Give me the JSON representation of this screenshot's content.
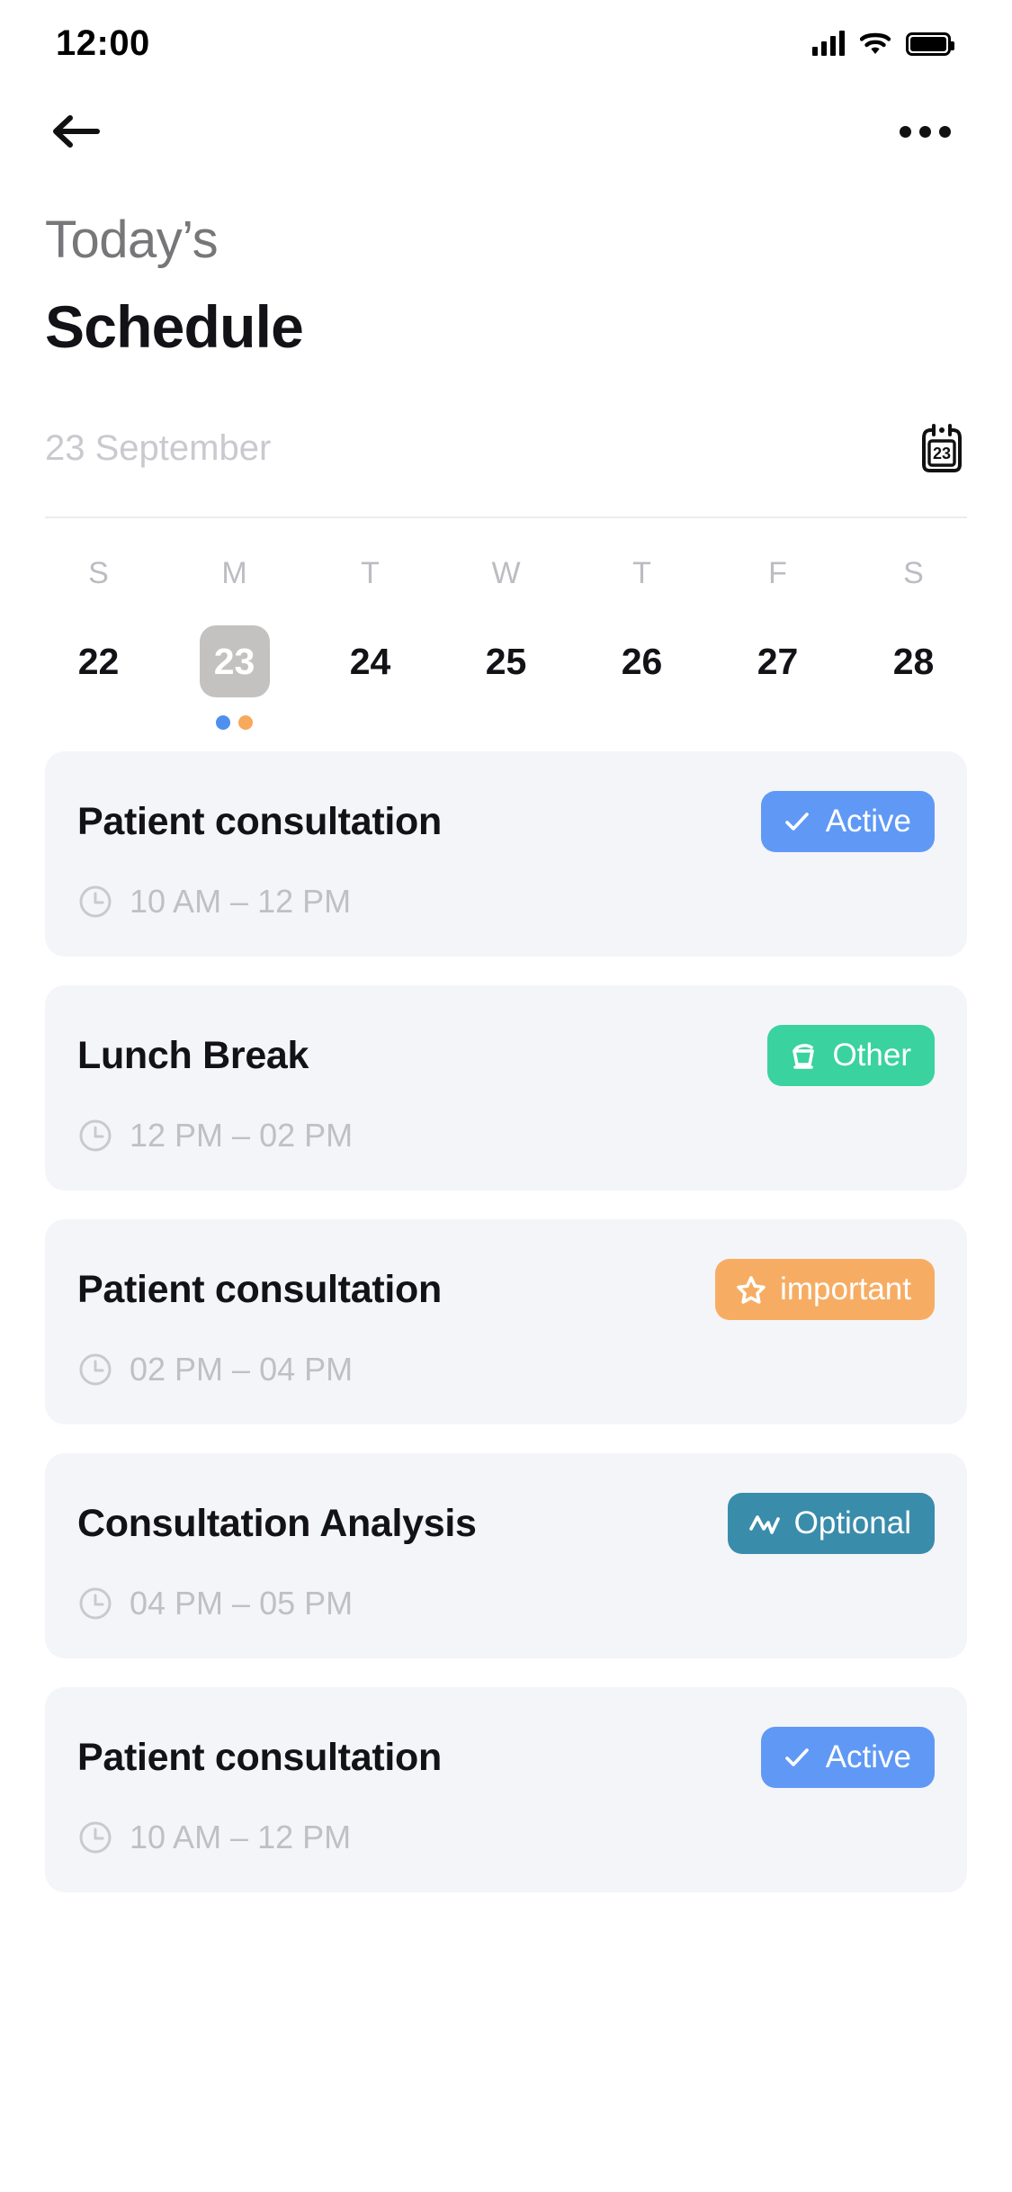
{
  "status_bar": {
    "time": "12:00",
    "signal_icon": "cellular-signal-icon",
    "wifi_icon": "wifi-icon",
    "battery_icon": "battery-full-icon"
  },
  "nav": {
    "back_icon": "arrow-left-icon",
    "more_icon": "more-options-icon"
  },
  "header": {
    "subtitle": "Today’s",
    "title": "Schedule"
  },
  "date_selector": {
    "label": "23 September",
    "calendar_icon": "calendar-icon",
    "calendar_icon_day": "23",
    "weekdays": [
      "S",
      "M",
      "T",
      "W",
      "T",
      "F",
      "S"
    ],
    "days": [
      {
        "num": "22",
        "selected": false,
        "dots": []
      },
      {
        "num": "23",
        "selected": true,
        "dots": [
          "#4f8ff0",
          "#f7a95c"
        ]
      },
      {
        "num": "24",
        "selected": false,
        "dots": []
      },
      {
        "num": "25",
        "selected": false,
        "dots": []
      },
      {
        "num": "26",
        "selected": false,
        "dots": []
      },
      {
        "num": "27",
        "selected": false,
        "dots": []
      },
      {
        "num": "28",
        "selected": false,
        "dots": []
      }
    ],
    "selected_pill_color": "#c4c2c0"
  },
  "events": [
    {
      "title": "Patient consultation",
      "time": "10 AM – 12 PM",
      "time_icon": "clock-icon",
      "badge": {
        "label": "Active",
        "icon": "check-icon",
        "color": "#6099f5"
      }
    },
    {
      "title": "Lunch Break",
      "time": "12 PM – 02 PM",
      "time_icon": "clock-icon",
      "badge": {
        "label": "Other",
        "icon": "coffee-cup-icon",
        "color": "#3ad29f"
      }
    },
    {
      "title": "Patient consultation",
      "time": "02 PM – 04 PM",
      "time_icon": "clock-icon",
      "badge": {
        "label": "important",
        "icon": "star-icon",
        "color": "#f6ad63"
      }
    },
    {
      "title": "Consultation Analysis",
      "time": "04 PM – 05 PM",
      "time_icon": "clock-icon",
      "badge": {
        "label": "Optional",
        "icon": "activity-pulse-icon",
        "color": "#3a8cab"
      }
    },
    {
      "title": "Patient consultation",
      "time": "10 AM – 12 PM",
      "time_icon": "clock-icon",
      "badge": {
        "label": "Active",
        "icon": "check-icon",
        "color": "#6099f5"
      }
    }
  ]
}
